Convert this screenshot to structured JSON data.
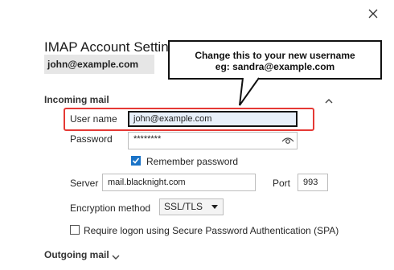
{
  "dialog": {
    "title": "IMAP Account Settings",
    "account_email": "john@example.com"
  },
  "callout": {
    "line1": "Change this to your new username",
    "line2": "eg: sandra@example.com"
  },
  "incoming": {
    "section_label": "Incoming mail",
    "username_label": "User name",
    "username_value": "john@example.com",
    "password_label": "Password",
    "password_value": "********",
    "remember_label": "Remember password",
    "remember_checked": true,
    "server_label": "Server",
    "server_value": "mail.blacknight.com",
    "port_label": "Port",
    "port_value": "993",
    "encryption_label": "Encryption method",
    "encryption_value": "SSL/TLS",
    "spa_label": "Require logon using Secure Password Authentication (SPA)",
    "spa_checked": false
  },
  "outgoing": {
    "section_label": "Outgoing mail"
  },
  "colors": {
    "highlight": "#e53935",
    "accent": "#1a73c7"
  },
  "icons": {
    "close": "close-icon",
    "collapse": "chevron-up-icon",
    "reveal": "eye-icon",
    "expand": "chevron-down-icon",
    "dropdown": "caret-down-icon",
    "check": "checkmark-icon"
  }
}
